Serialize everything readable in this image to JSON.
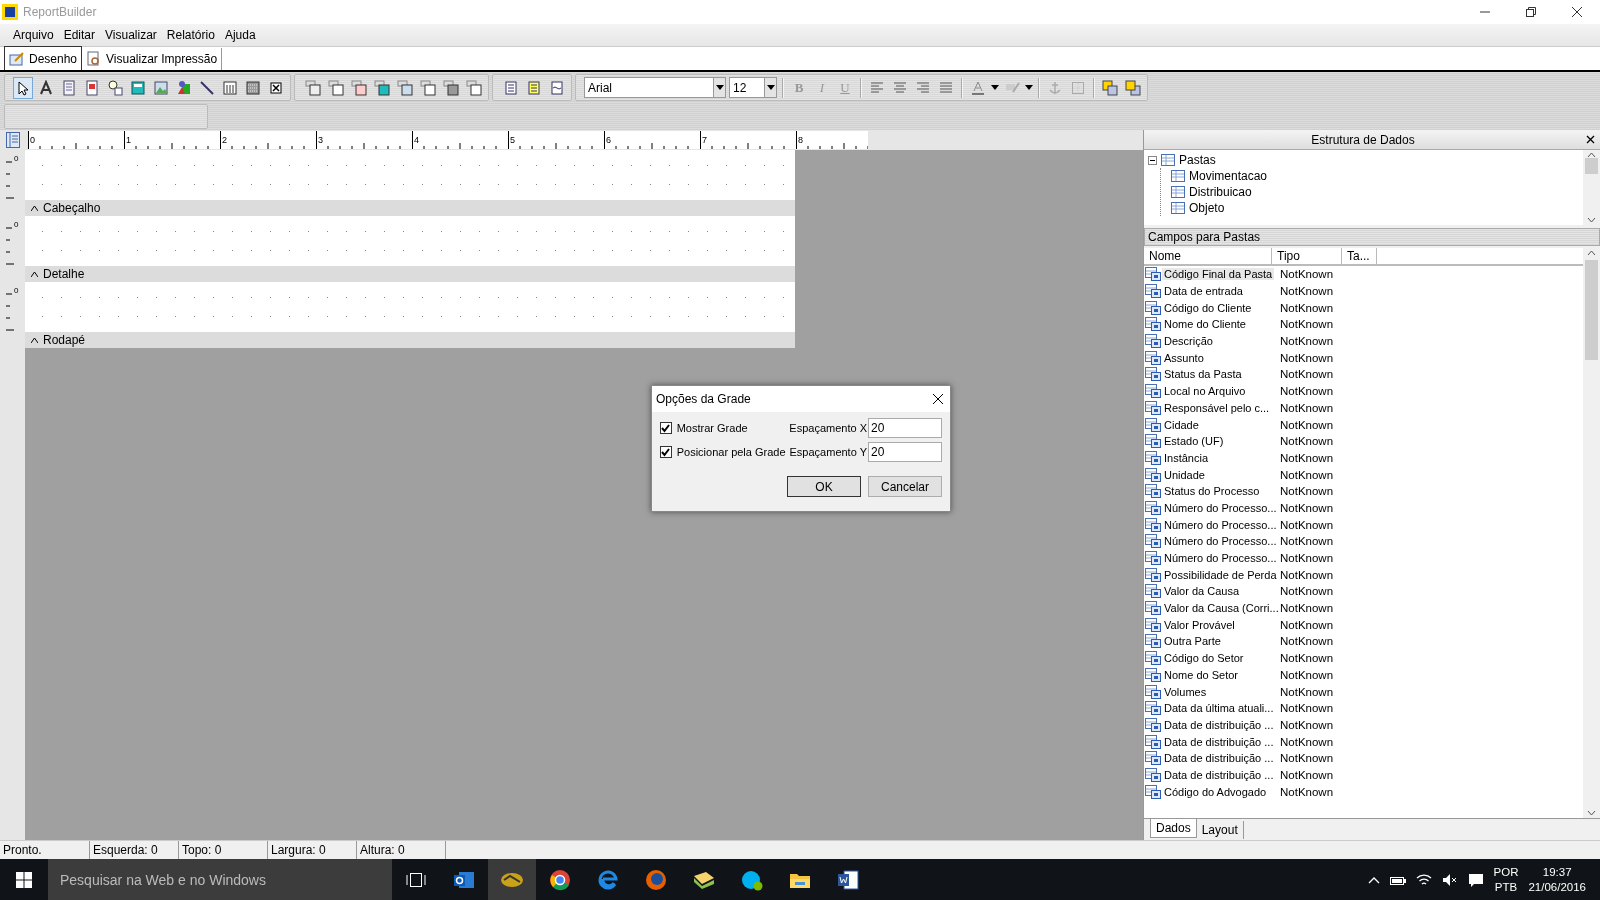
{
  "window": {
    "title": "ReportBuilder"
  },
  "menu": [
    "Arquivo",
    "Editar",
    "Visualizar",
    "Relatório",
    "Ajuda"
  ],
  "tabs": [
    {
      "label": "Desenho",
      "selected": true
    },
    {
      "label": "Visualizar Impressão",
      "selected": false
    }
  ],
  "toolbar": {
    "font": "Arial",
    "size": "12",
    "style_buttons": [
      "B",
      "I",
      "U"
    ]
  },
  "ruler": [
    "0",
    "1",
    "2",
    "3",
    "4",
    "5",
    "6",
    "7",
    "8"
  ],
  "bands": [
    {
      "label": "Cabeçalho",
      "ruler": "0"
    },
    {
      "label": "Detalhe",
      "ruler": "0"
    },
    {
      "label": "Rodapé",
      "ruler": "0"
    }
  ],
  "dialog": {
    "title": "Opções da Grade",
    "options": [
      {
        "label": "Mostrar Grade",
        "checked": true,
        "spacing_label": "Espaçamento X",
        "value": "20"
      },
      {
        "label": "Posicionar pela Grade",
        "checked": true,
        "spacing_label": "Espaçamento Y",
        "value": "20"
      }
    ],
    "buttons": [
      "OK",
      "Cancelar"
    ]
  },
  "data_panel": {
    "title": "Estrutura de Dados",
    "tree": [
      {
        "label": "Pastas",
        "expanded": true,
        "children": [
          {
            "label": "Movimentacao"
          },
          {
            "label": "Distribuicao"
          },
          {
            "label": "Objeto"
          }
        ]
      }
    ],
    "fields_title": "Campos para Pastas",
    "columns": [
      "Nome",
      "Tipo",
      "Ta..."
    ],
    "rows": [
      {
        "name": "Código Final da Pasta",
        "type": "NotKnown",
        "selected": true
      },
      {
        "name": "Data de entrada",
        "type": "NotKnown",
        "selected": false
      },
      {
        "name": "Código do Cliente",
        "type": "NotKnown",
        "selected": false
      },
      {
        "name": "Nome do Cliente",
        "type": "NotKnown",
        "selected": false
      },
      {
        "name": "Descrição",
        "type": "NotKnown",
        "selected": false
      },
      {
        "name": "Assunto",
        "type": "NotKnown",
        "selected": false
      },
      {
        "name": "Status da Pasta",
        "type": "NotKnown",
        "selected": false
      },
      {
        "name": "Local no Arquivo",
        "type": "NotKnown",
        "selected": false
      },
      {
        "name": "Responsável pelo c...",
        "type": "NotKnown",
        "selected": false
      },
      {
        "name": "Cidade",
        "type": "NotKnown",
        "selected": false
      },
      {
        "name": "Estado (UF)",
        "type": "NotKnown",
        "selected": false
      },
      {
        "name": "Instância",
        "type": "NotKnown",
        "selected": false
      },
      {
        "name": "Unidade",
        "type": "NotKnown",
        "selected": false
      },
      {
        "name": "Status do Processo",
        "type": "NotKnown",
        "selected": false
      },
      {
        "name": "Número do Processo...",
        "type": "NotKnown",
        "selected": false
      },
      {
        "name": "Número do Processo...",
        "type": "NotKnown",
        "selected": false
      },
      {
        "name": "Número do Processo...",
        "type": "NotKnown",
        "selected": false
      },
      {
        "name": "Número do Processo...",
        "type": "NotKnown",
        "selected": false
      },
      {
        "name": "Possibilidade de Perda",
        "type": "NotKnown",
        "selected": false
      },
      {
        "name": "Valor da Causa",
        "type": "NotKnown",
        "selected": false
      },
      {
        "name": "Valor da Causa (Corri...",
        "type": "NotKnown",
        "selected": false
      },
      {
        "name": "Valor Provável",
        "type": "NotKnown",
        "selected": false
      },
      {
        "name": "Outra Parte",
        "type": "NotKnown",
        "selected": false
      },
      {
        "name": "Código do Setor",
        "type": "NotKnown",
        "selected": false
      },
      {
        "name": "Nome do Setor",
        "type": "NotKnown",
        "selected": false
      },
      {
        "name": "Volumes",
        "type": "NotKnown",
        "selected": false
      },
      {
        "name": "Data da última atuali...",
        "type": "NotKnown",
        "selected": false
      },
      {
        "name": "Data de distribuição ...",
        "type": "NotKnown",
        "selected": false
      },
      {
        "name": "Data de distribuição ...",
        "type": "NotKnown",
        "selected": false
      },
      {
        "name": "Data de distribuição ...",
        "type": "NotKnown",
        "selected": false
      },
      {
        "name": "Data de distribuição ...",
        "type": "NotKnown",
        "selected": false
      },
      {
        "name": "Código do Advogado",
        "type": "NotKnown",
        "selected": false
      }
    ],
    "tabs": [
      {
        "label": "Dados",
        "selected": true
      },
      {
        "label": "Layout",
        "selected": false
      }
    ]
  },
  "status_bar": [
    "Pronto.",
    "Esquerda: 0",
    "Topo: 0",
    "Largura: 0",
    "Altura: 0"
  ],
  "taskbar": {
    "search_placeholder": "Pesquisar na Web e no Windows",
    "language": "POR",
    "layout": "PTB",
    "time": "19:37",
    "date": "21/06/2016"
  }
}
